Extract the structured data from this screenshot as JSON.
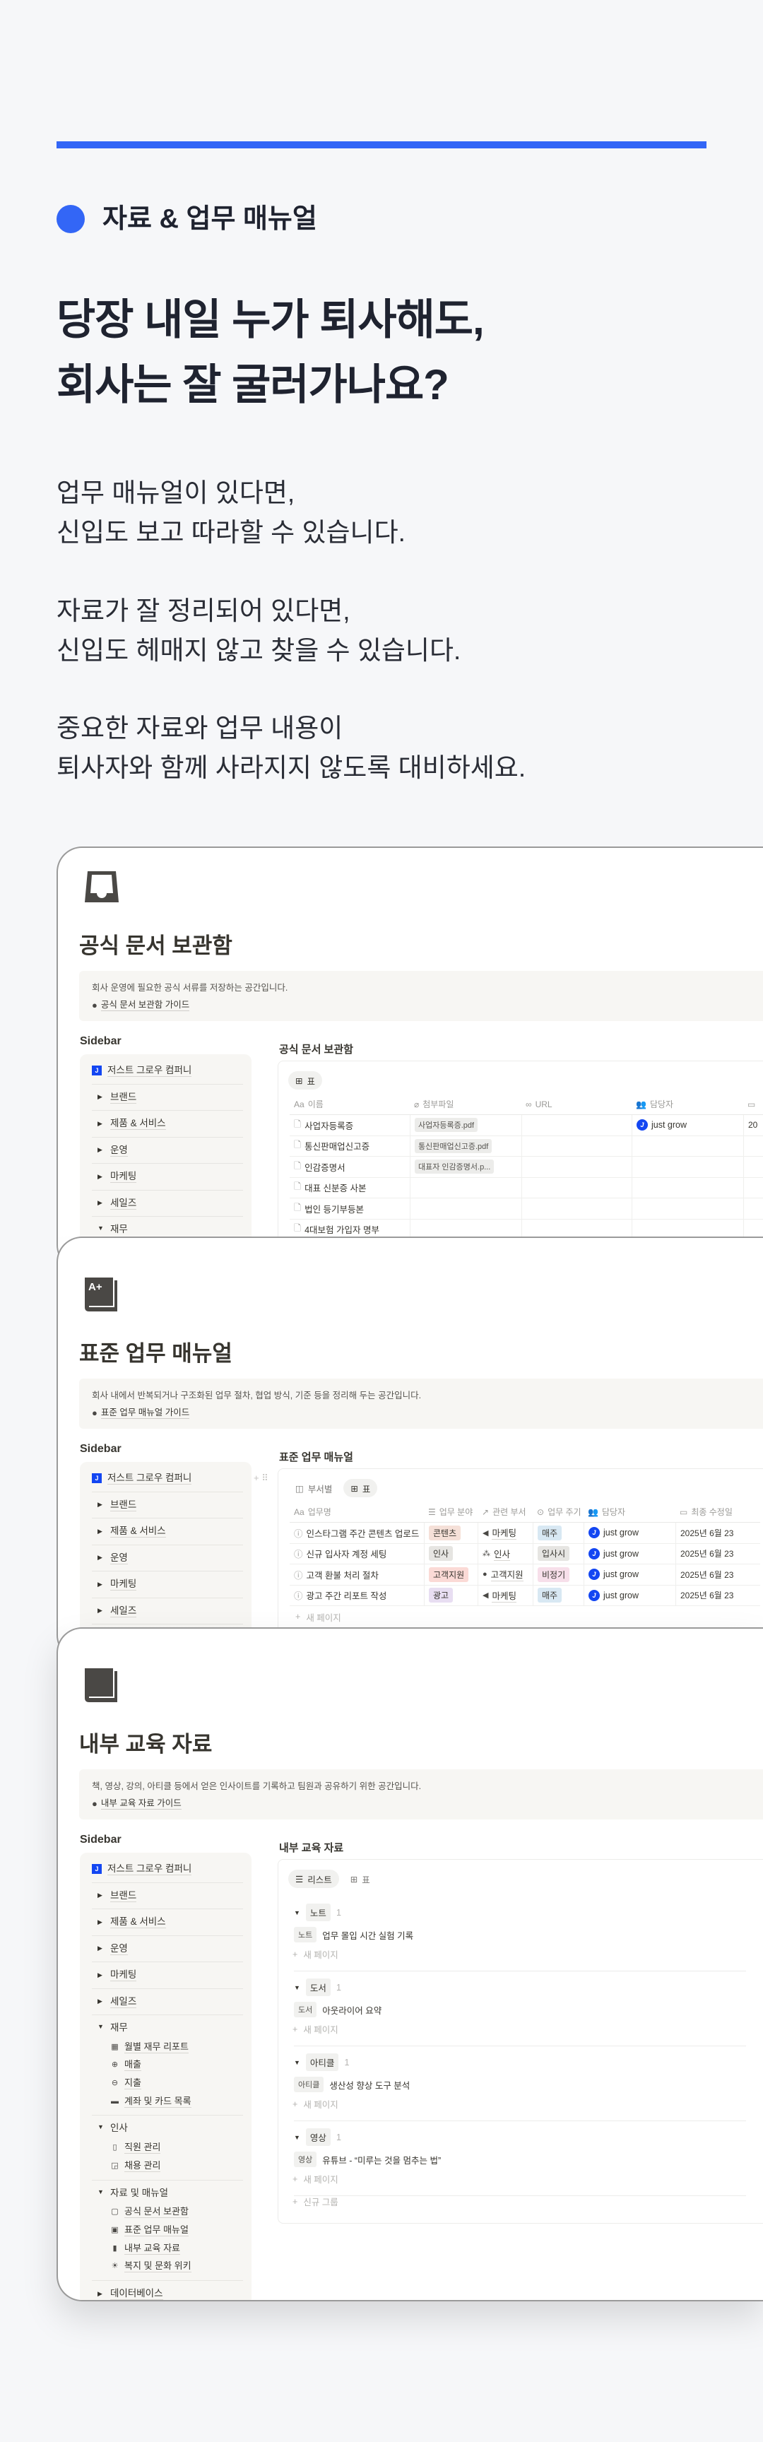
{
  "intro": {
    "eyebrow": "자료 & 업무 매뉴얼",
    "headline": [
      "당장 내일 누가 퇴사해도,",
      "회사는 잘 굴러가나요?"
    ],
    "paragraphs": [
      [
        "업무 매뉴얼이 있다면,",
        "신입도 보고 따라할 수 있습니다."
      ],
      [
        "자료가 잘 정리되어 있다면,",
        "신입도 헤매지 않고 찾을 수 있습니다."
      ],
      [
        "중요한 자료와 업무 내용이",
        "퇴사자와 함께 사라지지 않도록 대비하세요."
      ]
    ],
    "accent": "#3366f6"
  },
  "sidebar": {
    "label": "Sidebar",
    "company": "저스트 그로우 컴퍼니",
    "items": [
      {
        "label": "브랜드",
        "expanded": false
      },
      {
        "label": "제품 & 서비스",
        "expanded": false
      },
      {
        "label": "운영",
        "expanded": false
      },
      {
        "label": "마케팅",
        "expanded": false
      },
      {
        "label": "세일즈",
        "expanded": false
      },
      {
        "label": "재무",
        "expanded": true,
        "children": [
          {
            "label": "월별 재무 리포트",
            "icon": "calculator-icon"
          },
          {
            "label": "매출",
            "icon": "plus-circle-icon"
          },
          {
            "label": "지출",
            "icon": "minus-circle-icon"
          },
          {
            "label": "계좌 및 카드 목록",
            "icon": "card-icon"
          }
        ]
      },
      {
        "label": "인사",
        "expanded": true,
        "children": [
          {
            "label": "직원 관리",
            "icon": "id-badge-icon"
          },
          {
            "label": "채용 관리",
            "icon": "hiring-icon"
          }
        ]
      },
      {
        "label": "자료 및 매뉴얼",
        "expanded": true,
        "children": [
          {
            "label": "공식 문서 보관함",
            "icon": "inbox-icon"
          },
          {
            "label": "표준 업무 매뉴얼",
            "icon": "grade-book-icon"
          },
          {
            "label": "내부 교육 자료",
            "icon": "book-icon"
          },
          {
            "label": "복지 및 문화 위키",
            "icon": "sun-icon"
          }
        ]
      },
      {
        "label": "데이터베이스",
        "expanded": false
      }
    ]
  },
  "cards": [
    {
      "icon": "inbox-icon",
      "title": "공식 문서 보관함",
      "description": "회사 운영에 필요한 공식 서류를 저장하는 공간입니다.",
      "guide": "공식 문서 보관함 가이드",
      "db_title": "공식 문서 보관함",
      "tabs": [
        {
          "label": "표",
          "icon": "table-icon",
          "active": true
        }
      ],
      "columns": [
        {
          "label": "이름",
          "icon": "text-icon"
        },
        {
          "label": "첨부파일",
          "icon": "paperclip-icon"
        },
        {
          "label": "URL",
          "icon": "link-icon"
        },
        {
          "label": "담당자",
          "icon": "people-icon"
        },
        {
          "label": "",
          "icon": "calendar-icon"
        }
      ],
      "rows": [
        {
          "name": "사업자등록증",
          "file": "사업자등록증.pdf",
          "url": "",
          "owner": "just grow",
          "date": "20"
        },
        {
          "name": "통신판매업신고증",
          "file": "통신판매업신고증.pdf",
          "url": "",
          "owner": "",
          "date": ""
        },
        {
          "name": "인감증명서",
          "file": "대표자 인감증명서.p...",
          "url": "",
          "owner": "",
          "date": ""
        },
        {
          "name": "대표 신분증 사본",
          "file": "",
          "url": "",
          "owner": "",
          "date": ""
        },
        {
          "name": "법인 등기부등본",
          "file": "",
          "url": "",
          "owner": "",
          "date": ""
        },
        {
          "name": "4대보험 가입자 명부",
          "file": "",
          "url": "",
          "owner": "",
          "date": ""
        }
      ]
    },
    {
      "icon": "grade-book-icon",
      "title": "표준 업무 매뉴얼",
      "description": "회사 내에서 반복되거나 구조화된 업무 절차, 협업 방식, 기준 등을 정리해 두는 공간입니다.",
      "guide": "표준 업무 매뉴얼 가이드",
      "db_title": "표준 업무 매뉴얼",
      "tabs": [
        {
          "label": "부서별",
          "icon": "board-icon",
          "active": false
        },
        {
          "label": "표",
          "icon": "table-icon",
          "active": true
        }
      ],
      "columns": [
        {
          "label": "업무명",
          "icon": "text-icon"
        },
        {
          "label": "업무 분야",
          "icon": "list-icon"
        },
        {
          "label": "관련 부서",
          "icon": "relation-arrow-icon"
        },
        {
          "label": "업무 주기",
          "icon": "select-icon"
        },
        {
          "label": "담당자",
          "icon": "people-icon"
        },
        {
          "label": "최종 수정일",
          "icon": "calendar-icon"
        }
      ],
      "rows": [
        {
          "name": "인스타그램 주간 콘텐츠 업로드",
          "area": "콘텐츠",
          "area_color": "#f5e0d8",
          "dept": "마케팅",
          "dept_icon": "megaphone-icon",
          "cycle": "매주",
          "cycle_color": "#d8e8f3",
          "owner": "just grow",
          "date": "2025년 6월 23"
        },
        {
          "name": "신규 입사자 계정 세팅",
          "area": "인사",
          "area_color": "#e6e5e2",
          "dept": "인사",
          "dept_icon": "team-icon",
          "cycle": "입사시",
          "cycle_color": "#e6e5e2",
          "owner": "just grow",
          "date": "2025년 6월 23"
        },
        {
          "name": "고객 환불 처리 절차",
          "area": "고객지원",
          "area_color": "#fbdad6",
          "dept": "고객지원",
          "dept_icon": "speech-bubble-icon",
          "cycle": "비정기",
          "cycle_color": "#f7dfea",
          "owner": "just grow",
          "date": "2025년 6월 23"
        },
        {
          "name": "광고 주간 리포트 작성",
          "area": "광고",
          "area_color": "#e8def2",
          "dept": "마케팅",
          "dept_icon": "megaphone-icon",
          "cycle": "매주",
          "cycle_color": "#d8e8f3",
          "owner": "just grow",
          "date": "2025년 6월 23"
        }
      ],
      "new_page": "새 페이지"
    },
    {
      "icon": "book-icon",
      "title": "내부 교육 자료",
      "description": "책, 영상, 강의, 아티클 등에서 얻은 인사이트를 기록하고 팀원과 공유하기 위한 공간입니다.",
      "guide": "내부 교육 자료 가이드",
      "db_title": "내부 교육 자료",
      "tabs": [
        {
          "label": "리스트",
          "icon": "list-icon",
          "active": true
        },
        {
          "label": "표",
          "icon": "table-icon",
          "active": false
        }
      ],
      "groups": [
        {
          "label": "노트",
          "count": "1",
          "items": [
            {
              "tag": "노트",
              "title": "업무 몰입 시간 실험 기록"
            }
          ]
        },
        {
          "label": "도서",
          "count": "1",
          "items": [
            {
              "tag": "도서",
              "title": "아웃라이어 요약"
            }
          ]
        },
        {
          "label": "아티클",
          "count": "1",
          "items": [
            {
              "tag": "아티클",
              "title": "생산성 향상 도구 분석"
            }
          ]
        },
        {
          "label": "영상",
          "count": "1",
          "items": [
            {
              "tag": "영상",
              "title": "유튜브 - “미루는 것을 멈추는 법”"
            }
          ]
        }
      ],
      "new_page": "새 페이지",
      "new_group": "신규 그룹"
    }
  ]
}
